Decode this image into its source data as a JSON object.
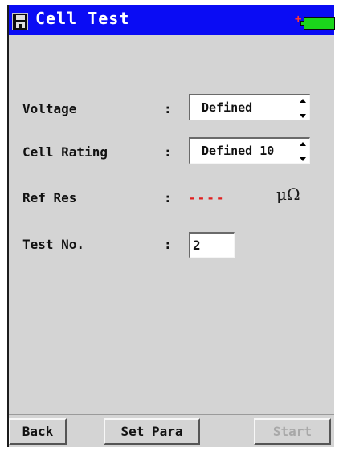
{
  "header": {
    "title": "Cell Test",
    "save_icon": "floppy-disk-icon",
    "charging_symbol": "+",
    "battery_icon": "battery-icon",
    "battery_color": "#1bd61b"
  },
  "form": {
    "voltage": {
      "label": "Voltage",
      "separator": ":",
      "value": "Defined"
    },
    "cell_rating": {
      "label": "Cell Rating",
      "separator": ":",
      "value": "Defined 10"
    },
    "ref_res": {
      "label": "Ref Res",
      "separator": ":",
      "value": "----",
      "unit": "μΩ",
      "value_color": "#e02020"
    },
    "test_no": {
      "label": "Test No.",
      "separator": ":",
      "value": "2"
    }
  },
  "footer": {
    "back_label": "Back",
    "set_para_label": "Set Para",
    "start_label": "Start"
  },
  "colors": {
    "title_bar": "#0a0cf4",
    "background": "#d4d4d4",
    "disabled_text": "#a8a8a8"
  }
}
